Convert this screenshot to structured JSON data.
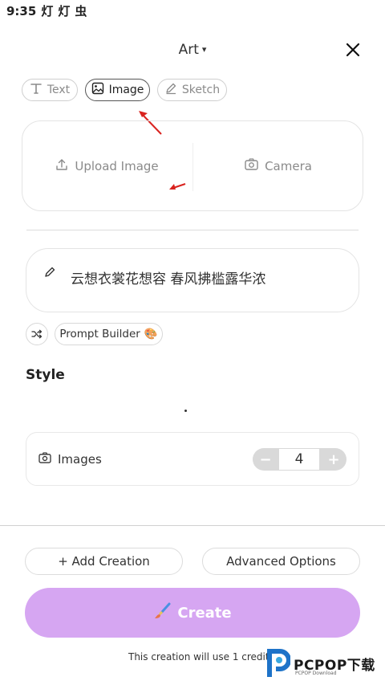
{
  "status_bar": {
    "time": "9:35",
    "icons": [
      "灯",
      "灯",
      "虫"
    ]
  },
  "header": {
    "title": "Art",
    "caret": "▾",
    "close_icon": "close-icon"
  },
  "mode_tabs": [
    {
      "label": "Text",
      "icon": "text-icon",
      "active": false
    },
    {
      "label": "Image",
      "icon": "image-icon",
      "active": true
    },
    {
      "label": "Sketch",
      "icon": "pencil-icon",
      "active": false
    }
  ],
  "upload": {
    "upload_label": "Upload Image",
    "camera_label": "Camera"
  },
  "prompt": {
    "text": "云想衣裳花想容 春风拂槛露华浓",
    "icon": "pencil-icon"
  },
  "prompt_builder": {
    "label": "Prompt Builder",
    "emoji": "🎨"
  },
  "style": {
    "heading": "Style"
  },
  "images_setting": {
    "label": "Images",
    "value": "4",
    "minus": "−",
    "plus": "+"
  },
  "actions": {
    "add_creation": "+ Add Creation",
    "advanced_options": "Advanced Options",
    "create": "Create"
  },
  "credit_note": "This creation will use 1 credit.",
  "watermark": {
    "text": "PCPOP下载",
    "sub": "PCPOP Download"
  },
  "colors": {
    "create_bg": "#d6a6f2",
    "arrow": "#d9231f"
  }
}
